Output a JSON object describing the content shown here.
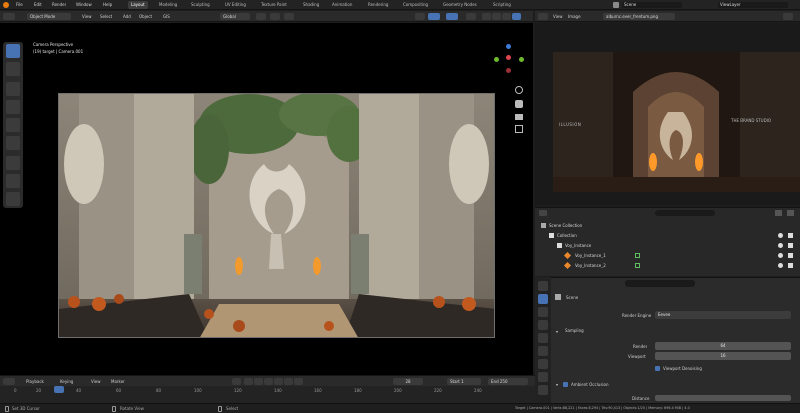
{
  "topbar": {
    "menus": [
      "File",
      "Edit",
      "Render",
      "Window",
      "Help"
    ],
    "workspaces": [
      "Layout",
      "Modeling",
      "Sculpting",
      "UV Editing",
      "Texture Paint",
      "Shading",
      "Animation",
      "Rendering",
      "Compositing",
      "Geometry Nodes",
      "Scripting"
    ],
    "active_workspace": "Layout",
    "scene_label": "Scene",
    "view_layer_label": "ViewLayer"
  },
  "viewport_header": {
    "mode": "Object Mode",
    "menus": [
      "View",
      "Select",
      "Add",
      "Object",
      "GIS"
    ],
    "transform_orientation": "Global",
    "overlay_title": "Camera Perspective",
    "overlay_sub": "(19) target | Camera.001"
  },
  "image_editor": {
    "menus": [
      "View",
      "Image"
    ],
    "image_name": "alburnc.ever_frentum.png",
    "render_caption_left": "ILLUSION",
    "render_caption_right": "THE BRAND STUDIO"
  },
  "outliner": {
    "search_placeholder": "",
    "rows": [
      {
        "label": "Scene Collection",
        "indent": 0,
        "selected": false
      },
      {
        "label": "Collection",
        "indent": 1,
        "selected": false
      },
      {
        "label": "Voy_Instance",
        "indent": 2,
        "selected": false
      },
      {
        "label": "Voy_Instance_1",
        "indent": 3,
        "selected": false
      },
      {
        "label": "Voy_Instance_2",
        "indent": 3,
        "selected": false
      }
    ]
  },
  "properties": {
    "context_name": "Scene",
    "render_engine_label": "Render Engine",
    "render_engine_value": "Eevee",
    "sampling_label": "Sampling",
    "render_label": "Render",
    "render_value": "64",
    "viewport_label": "Viewport",
    "viewport_value": "16",
    "viewport_denoise_label": "Viewport Denoising",
    "ambient_occlusion_label": "Ambient Occlusion",
    "distance_label": "Distance"
  },
  "timeline": {
    "menus": [
      "Playback",
      "Keying",
      "View",
      "Marker"
    ],
    "current_frame": "28",
    "start_label": "Start",
    "start_value": "1",
    "end_label": "End",
    "end_value": "250",
    "ticks": [
      "0",
      "20",
      "40",
      "60",
      "80",
      "100",
      "120",
      "140",
      "160",
      "180",
      "200",
      "220",
      "240"
    ]
  },
  "statusbar": {
    "left_hint": "Set 3D Cursor",
    "mid_hint": "Rotate View",
    "right_hint": "Select",
    "info": "Target | Camera.001 | Verts:88,221 | Faces:8,294 | Tris:90,413 | Objects:1/20 | Memory: 696.4 MiB | 4.0"
  },
  "colors": {
    "accent": "#4772b3",
    "x_axis": "#e0444f",
    "y_axis": "#6fba2c",
    "z_axis": "#3d7bd6"
  }
}
